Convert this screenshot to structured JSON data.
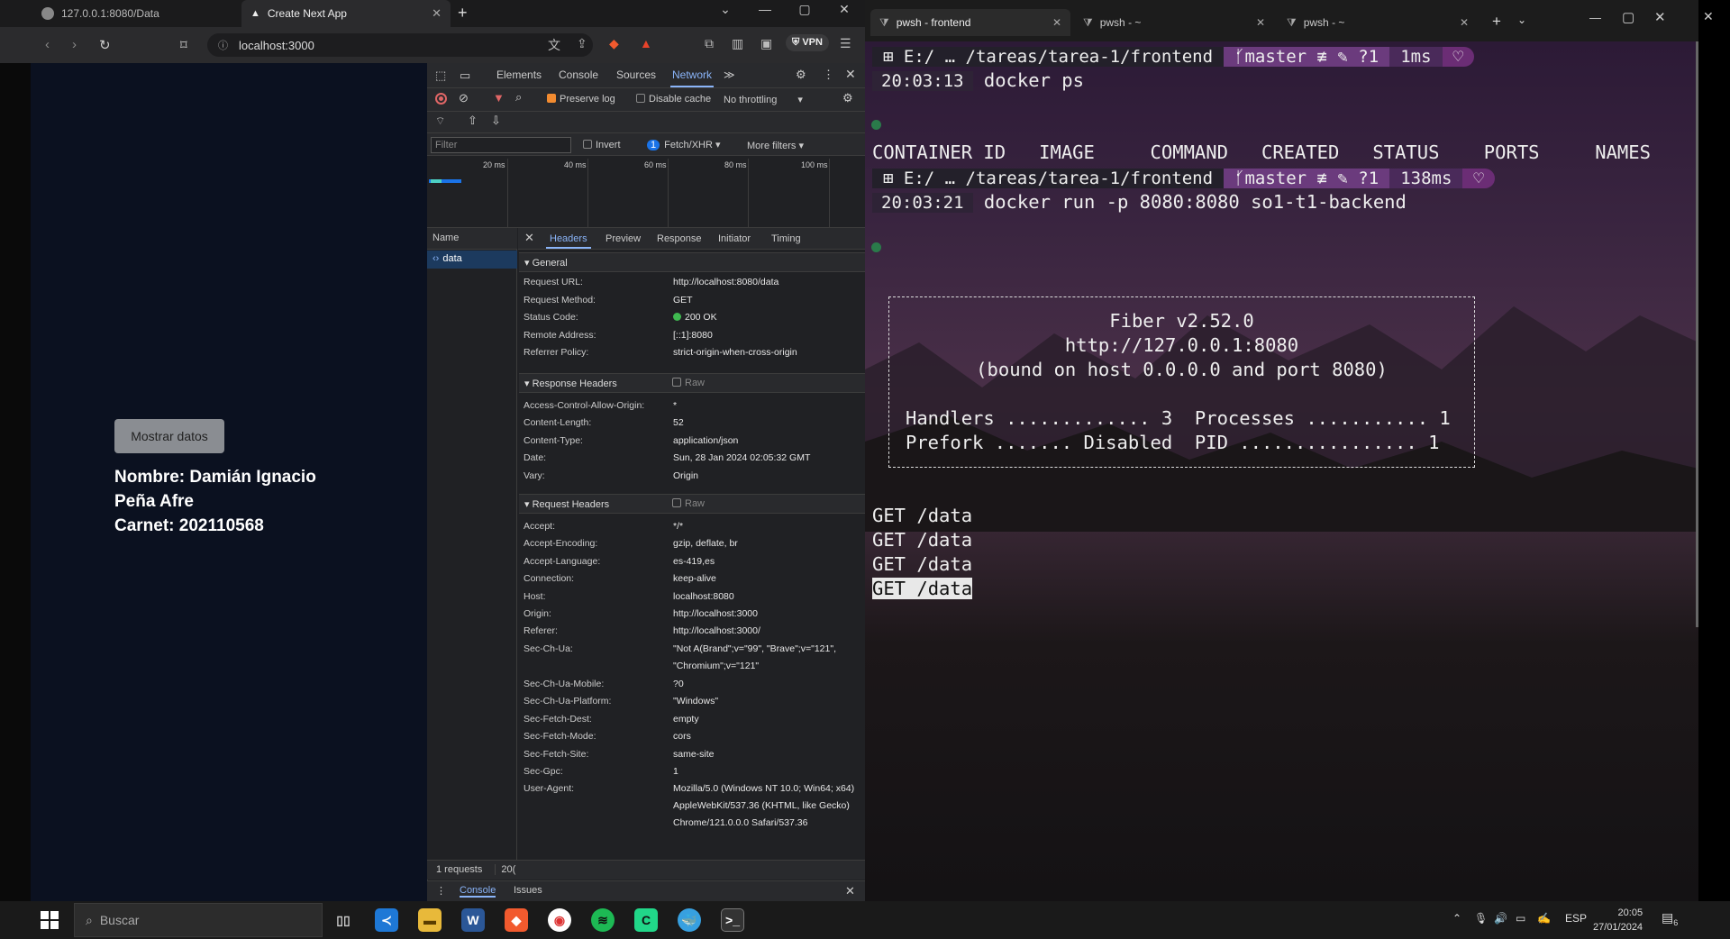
{
  "browser": {
    "tabs": [
      {
        "label": "127.0.0.1:8080/Data"
      },
      {
        "label": "Create Next App"
      }
    ],
    "url": "localhost:3000",
    "vpn_label": "VPN",
    "page": {
      "button_label": "Mostrar datos",
      "lines": [
        "Nombre: Damián Ignacio",
        "Peña Afre",
        "Carnet: 202110568"
      ]
    }
  },
  "devtools": {
    "tabs": [
      "Elements",
      "Console",
      "Sources",
      "Network"
    ],
    "active_tab": "Network",
    "toolbar": {
      "preserve_log": "Preserve log",
      "disable_cache": "Disable cache",
      "throttling": "No throttling"
    },
    "filter": {
      "placeholder": "Filter",
      "invert": "Invert",
      "badge": "1",
      "type": "Fetch/XHR",
      "more": "More filters"
    },
    "timeline_ticks": [
      "20 ms",
      "40 ms",
      "60 ms",
      "80 ms",
      "100 ms"
    ],
    "name_header": "Name",
    "request_name": "data",
    "detail_tabs": [
      "Headers",
      "Preview",
      "Response",
      "Initiator",
      "Timing"
    ],
    "general": {
      "title": "General",
      "rows": [
        {
          "k": "Request URL:",
          "v": "http://localhost:8080/data"
        },
        {
          "k": "Request Method:",
          "v": "GET"
        },
        {
          "k": "Status Code:",
          "v": "200 OK"
        },
        {
          "k": "Remote Address:",
          "v": "[::1]:8080"
        },
        {
          "k": "Referrer Policy:",
          "v": "strict-origin-when-cross-origin"
        }
      ]
    },
    "response_headers": {
      "title": "Response Headers",
      "raw": "Raw",
      "rows": [
        {
          "k": "Access-Control-Allow-Origin:",
          "v": "*"
        },
        {
          "k": "Content-Length:",
          "v": "52"
        },
        {
          "k": "Content-Type:",
          "v": "application/json"
        },
        {
          "k": "Date:",
          "v": "Sun, 28 Jan 2024 02:05:32 GMT"
        },
        {
          "k": "Vary:",
          "v": "Origin"
        }
      ]
    },
    "request_headers": {
      "title": "Request Headers",
      "raw": "Raw",
      "rows": [
        {
          "k": "Accept:",
          "v": "*/*"
        },
        {
          "k": "Accept-Encoding:",
          "v": "gzip, deflate, br"
        },
        {
          "k": "Accept-Language:",
          "v": "es-419,es"
        },
        {
          "k": "Connection:",
          "v": "keep-alive"
        },
        {
          "k": "Host:",
          "v": "localhost:8080"
        },
        {
          "k": "Origin:",
          "v": "http://localhost:3000"
        },
        {
          "k": "Referer:",
          "v": "http://localhost:3000/"
        },
        {
          "k": "Sec-Ch-Ua:",
          "v": "\"Not A(Brand\";v=\"99\", \"Brave\";v=\"121\", \"Chromium\";v=\"121\""
        },
        {
          "k": "Sec-Ch-Ua-Mobile:",
          "v": "?0"
        },
        {
          "k": "Sec-Ch-Ua-Platform:",
          "v": "\"Windows\""
        },
        {
          "k": "Sec-Fetch-Dest:",
          "v": "empty"
        },
        {
          "k": "Sec-Fetch-Mode:",
          "v": "cors"
        },
        {
          "k": "Sec-Fetch-Site:",
          "v": "same-site"
        },
        {
          "k": "Sec-Gpc:",
          "v": "1"
        },
        {
          "k": "User-Agent:",
          "v": "Mozilla/5.0 (Windows NT 10.0; Win64; x64) AppleWebKit/537.36 (KHTML, like Gecko) Chrome/121.0.0.0 Safari/537.36"
        }
      ]
    },
    "status": {
      "requests": "1 requests",
      "transferred": "20("
    },
    "drawer_tabs": [
      "Console",
      "Issues"
    ]
  },
  "terminal": {
    "tabs": [
      "pwsh - frontend",
      "pwsh - ~",
      "pwsh - ~"
    ],
    "prompt1": {
      "path": "E:/ … /tareas/tarea-1/frontend",
      "git": "master ≢ ✎ ?1",
      "time": "1ms",
      "clock": "20:03:13",
      "command": "docker ps"
    },
    "ps_header": "CONTAINER ID   IMAGE     COMMAND   CREATED   STATUS    PORTS     NAMES",
    "prompt2": {
      "path": "E:/ … /tareas/tarea-1/frontend",
      "git": "master ≢ ✎ ?1",
      "time": "138ms",
      "clock": "20:03:21",
      "command": "docker run -p 8080:8080 so1-t1-backend"
    },
    "fiber": [
      "Fiber v2.52.0",
      "http://127.0.0.1:8080",
      "(bound on host 0.0.0.0 and port 8080)",
      "",
      "Handlers ............. 3  Processes ........... 1",
      "Prefork ....... Disabled  PID ................ 1"
    ],
    "log": [
      "GET /data",
      "GET /data",
      "GET /data",
      "GET /data"
    ]
  },
  "taskbar": {
    "search_placeholder": "Buscar",
    "lang": "ESP",
    "time": "20:05",
    "date": "27/01/2024",
    "notif_count": "6"
  }
}
